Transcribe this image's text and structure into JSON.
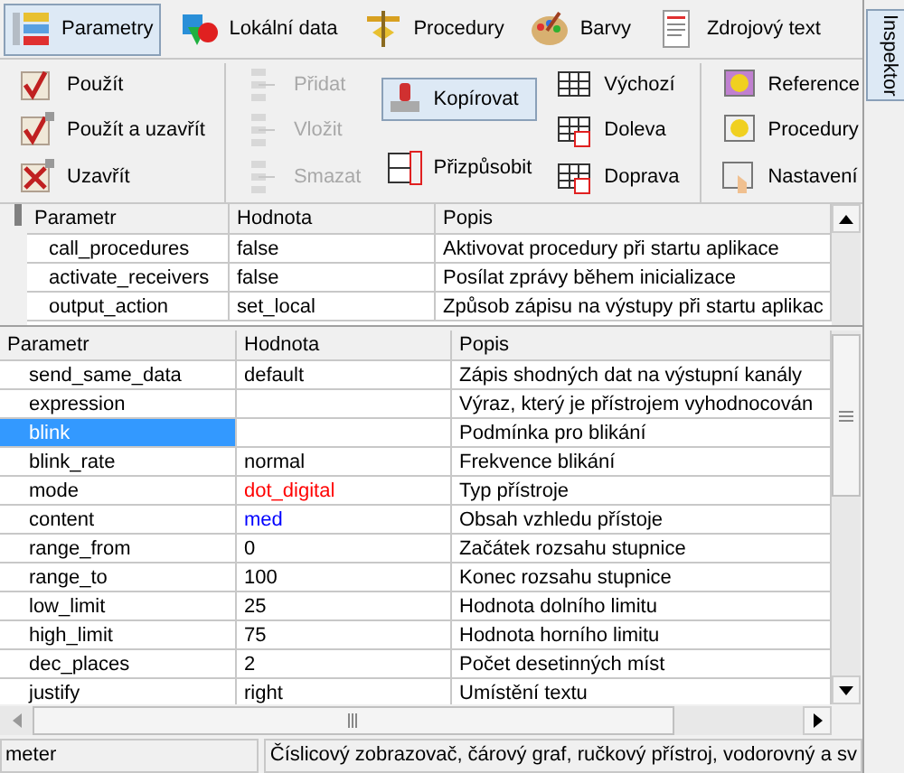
{
  "tabs": [
    {
      "label": "Parametry",
      "selected": true
    },
    {
      "label": "Lokální data",
      "selected": false
    },
    {
      "label": "Procedury",
      "selected": false
    },
    {
      "label": "Barvy",
      "selected": false
    },
    {
      "label": "Zdrojový text",
      "selected": false
    }
  ],
  "side_tab": {
    "label": "Inspektor",
    "selected": true
  },
  "toolbar": [
    [
      {
        "label": "Použít",
        "disabled": false,
        "pressed": false
      },
      {
        "label": "Použít a uzavřít",
        "disabled": false,
        "pressed": false
      },
      {
        "label": "Uzavřít",
        "disabled": false,
        "pressed": false
      }
    ],
    [
      {
        "label": "Přidat",
        "disabled": true,
        "pressed": false
      },
      {
        "label": "Vložit",
        "disabled": true,
        "pressed": false
      },
      {
        "label": "Smazat",
        "disabled": true,
        "pressed": false
      }
    ],
    [
      {
        "label": "Kopírovat",
        "disabled": false,
        "pressed": true
      },
      {
        "label": "Přizpůsobit",
        "disabled": false,
        "pressed": false
      }
    ],
    [
      {
        "label": "Výchozí",
        "disabled": false,
        "pressed": false
      },
      {
        "label": "Doleva",
        "disabled": false,
        "pressed": false
      },
      {
        "label": "Doprava",
        "disabled": false,
        "pressed": false
      }
    ],
    [
      {
        "label": "Reference",
        "disabled": false,
        "pressed": false
      },
      {
        "label": "Procedury",
        "disabled": false,
        "pressed": false
      },
      {
        "label": "Nastavení",
        "disabled": false,
        "pressed": false
      }
    ]
  ],
  "upper_table": {
    "columns": [
      "Parametr",
      "Hodnota",
      "Popis"
    ],
    "rows": [
      {
        "param": "call_procedures",
        "value": "false",
        "desc": "Aktivovat procedury při startu aplikace"
      },
      {
        "param": "activate_receivers",
        "value": "false",
        "desc": "Posílat zprávy během inicializace"
      },
      {
        "param": "output_action",
        "value": "set_local",
        "desc": "Způsob zápisu na výstupy při startu aplikac"
      }
    ]
  },
  "lower_table": {
    "columns": [
      "Parametr",
      "Hodnota",
      "Popis"
    ],
    "rows": [
      {
        "param": "send_same_data",
        "value": "default",
        "desc": "Zápis shodných dat na výstupní kanály",
        "selected": false
      },
      {
        "param": "expression",
        "value": "",
        "desc": "Výraz, který je přístrojem vyhodnocován",
        "selected": false
      },
      {
        "param": "blink",
        "value": "",
        "desc": "Podmínka pro blikání",
        "selected": true
      },
      {
        "param": "blink_rate",
        "value": "normal",
        "desc": "Frekvence blikání",
        "selected": false
      },
      {
        "param": "mode",
        "value": "dot_digital",
        "desc": "Typ přístroje",
        "selected": false,
        "color": "#ff0000"
      },
      {
        "param": "content",
        "value": "med",
        "desc": "Obsah vzhledu přístoje",
        "selected": false,
        "color": "#0000ff"
      },
      {
        "param": "range_from",
        "value": "0",
        "desc": "Začátek rozsahu stupnice",
        "selected": false
      },
      {
        "param": "range_to",
        "value": "100",
        "desc": "Konec rozsahu stupnice",
        "selected": false
      },
      {
        "param": "low_limit",
        "value": "25",
        "desc": "Hodnota dolního limitu",
        "selected": false
      },
      {
        "param": "high_limit",
        "value": "75",
        "desc": "Hodnota horního limitu",
        "selected": false
      },
      {
        "param": "dec_places",
        "value": "2",
        "desc": "Počet desetinných míst",
        "selected": false
      },
      {
        "param": "justify",
        "value": "right",
        "desc": "Umístění textu",
        "selected": false
      }
    ]
  },
  "status_bar": [
    "meter",
    "Číslicový zobrazovač, čárový graf, ručkový přístroj, vodorovný a sv"
  ]
}
